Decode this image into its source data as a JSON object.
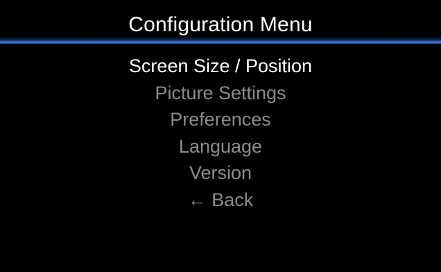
{
  "header": {
    "title": "Configuration Menu"
  },
  "menu": {
    "selected_index": 0,
    "items": [
      {
        "label": "Screen Size / Position"
      },
      {
        "label": "Picture Settings"
      },
      {
        "label": "Preferences"
      },
      {
        "label": "Language"
      },
      {
        "label": "Version"
      },
      {
        "label": "← Back"
      }
    ]
  },
  "colors": {
    "background": "#000000",
    "title_text": "#ffffff",
    "accent_line": "#3a6fc4",
    "selected_text": "#ffffff",
    "unselected_text": "#8c8c8c"
  }
}
